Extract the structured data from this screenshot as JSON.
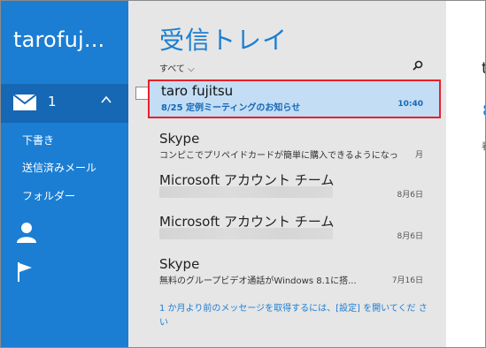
{
  "nav": {
    "account_name": "tarofuj...",
    "inbox": {
      "unread_count": "1"
    },
    "links": [
      "下書き",
      "送信済みメール",
      "フォルダー"
    ],
    "icons": [
      "mail-icon",
      "chevron-up-icon",
      "person-icon",
      "flag-icon"
    ]
  },
  "list": {
    "title": "受信トレイ",
    "filter_label": "すべて ⌵",
    "messages": [
      {
        "sender": "taro fujitsu",
        "preview": "8/25 定例ミーティングのお知らせ",
        "date": "10:40",
        "selected": true
      },
      {
        "sender": "Skype",
        "preview": "コンピこでプリペイドカードが簡単に購入できるようになっ...",
        "date": "月",
        "selected": false
      },
      {
        "sender": "Microsoft アカウント チーム",
        "preview": "",
        "date": "8月6日",
        "selected": false
      },
      {
        "sender": "Microsoft アカウント チーム",
        "preview": "",
        "date": "8月6日",
        "selected": false
      },
      {
        "sender": "Skype",
        "preview": "無料のグループビデオ通話がWindows 8.1に搭...",
        "date": "7月16日",
        "selected": false
      }
    ],
    "footer_link": "1 か月より前のメッセージを取得するには、[設定] を開いてくだ さい"
  },
  "reading": {
    "from": "t",
    "subject": "8",
    "meta": "春"
  },
  "colors": {
    "accent": "#1b7ed3",
    "selected_bg": "#c3ddf4",
    "highlight_border": "#e8202a",
    "list_bg": "#e6e6e6"
  }
}
